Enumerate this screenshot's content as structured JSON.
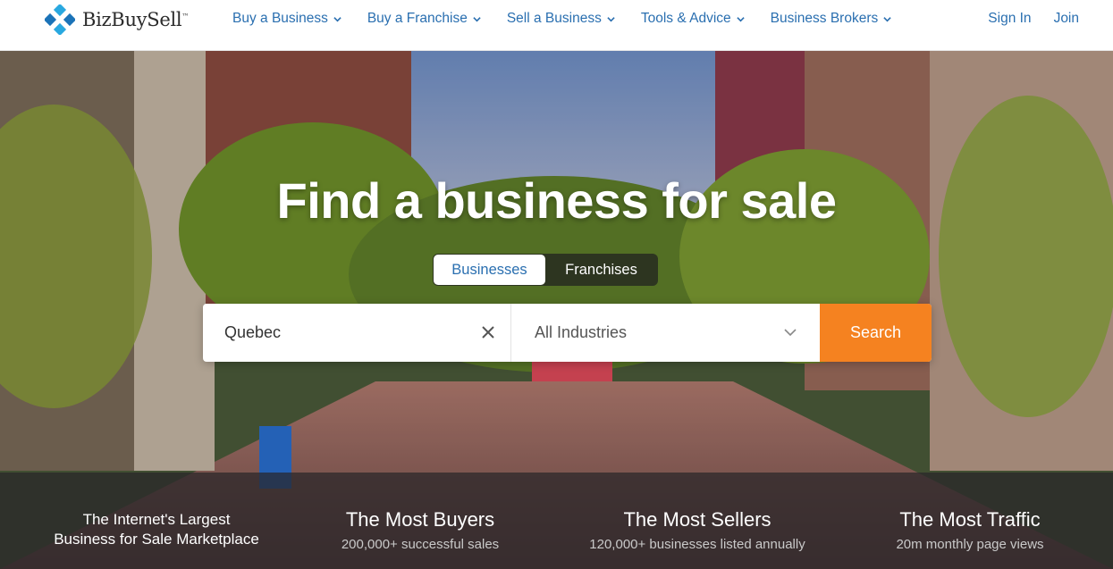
{
  "header": {
    "logo_text": "BizBuySell",
    "logo_mark": "™",
    "nav": [
      {
        "label": "Buy a Business"
      },
      {
        "label": "Buy a Franchise"
      },
      {
        "label": "Sell a Business"
      },
      {
        "label": "Tools & Advice"
      },
      {
        "label": "Business Brokers"
      }
    ],
    "sign_in": "Sign In",
    "join": "Join"
  },
  "hero": {
    "title": "Find a business for sale",
    "tabs": {
      "businesses": "Businesses",
      "franchises": "Franchises"
    },
    "search": {
      "location_value": "Quebec",
      "industry_value": "All Industries",
      "button": "Search"
    }
  },
  "stats": {
    "tagline_line1": "The Internet's Largest",
    "tagline_line2": "Business for Sale Marketplace",
    "items": [
      {
        "heading": "The Most Buyers",
        "sub": "200,000+ successful sales"
      },
      {
        "heading": "The Most Sellers",
        "sub": "120,000+ businesses listed annually"
      },
      {
        "heading": "The Most Traffic",
        "sub": "20m monthly page views"
      }
    ]
  },
  "colors": {
    "brand_blue": "#2a6fb0",
    "accent_orange": "#f58220"
  }
}
